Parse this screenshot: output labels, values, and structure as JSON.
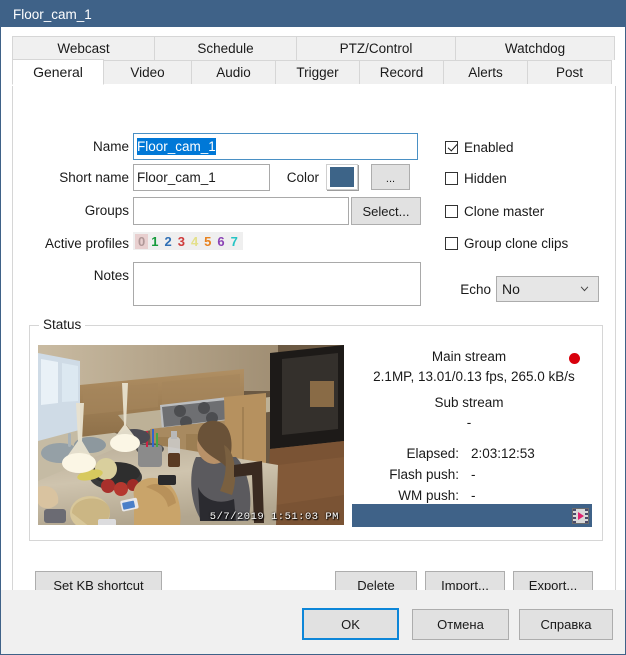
{
  "window": {
    "title": "Floor_cam_1"
  },
  "tabs": {
    "row1": [
      {
        "label": "Webcast",
        "active": false
      },
      {
        "label": "Schedule",
        "active": false
      },
      {
        "label": "PTZ/Control",
        "active": false
      },
      {
        "label": "Watchdog",
        "active": false
      }
    ],
    "row2": [
      {
        "label": "General",
        "active": true
      },
      {
        "label": "Video",
        "active": false
      },
      {
        "label": "Audio",
        "active": false
      },
      {
        "label": "Trigger",
        "active": false
      },
      {
        "label": "Record",
        "active": false
      },
      {
        "label": "Alerts",
        "active": false
      },
      {
        "label": "Post",
        "active": false
      }
    ]
  },
  "form": {
    "name_label": "Name",
    "name_value": "Floor_cam_1",
    "short_name_label": "Short name",
    "short_name_value": "Floor_cam_1",
    "color_label": "Color",
    "color_value": "#3d6488",
    "color_button_label": "...",
    "groups_label": "Groups",
    "groups_value": "",
    "select_button_label": "Select...",
    "active_profiles_label": "Active profiles",
    "profiles": [
      {
        "digit": "0",
        "color": "#b09898",
        "enabled": false
      },
      {
        "digit": "1",
        "color": "#169b3c",
        "enabled": true
      },
      {
        "digit": "2",
        "color": "#2f6fb5",
        "enabled": true
      },
      {
        "digit": "3",
        "color": "#cf3b3b",
        "enabled": true
      },
      {
        "digit": "4",
        "color": "#e4e08a",
        "enabled": true
      },
      {
        "digit": "5",
        "color": "#e8821e",
        "enabled": true
      },
      {
        "digit": "6",
        "color": "#8b43b5",
        "enabled": true
      },
      {
        "digit": "7",
        "color": "#25c4c4",
        "enabled": true
      }
    ],
    "notes_label": "Notes",
    "notes_value": "",
    "checkboxes": [
      {
        "label": "Enabled",
        "checked": true
      },
      {
        "label": "Hidden",
        "checked": false
      },
      {
        "label": "Clone master",
        "checked": false
      },
      {
        "label": "Group clone clips",
        "checked": false
      }
    ],
    "echo_label": "Echo",
    "echo_value": "No"
  },
  "status": {
    "group_title": "Status",
    "preview_timestamp": "5/7/2019 1:51:03 PM",
    "main_stream_label": "Main stream",
    "main_stream_info": "2.1MP, 13.01/0.13 fps,  265.0 kB/s",
    "sub_stream_label": "Sub stream",
    "sub_stream_info": "-",
    "elapsed_label": "Elapsed:",
    "elapsed_value": "2:03:12:53",
    "flash_push_label": "Flash push:",
    "flash_push_value": "-",
    "wm_push_label": "WM push:",
    "wm_push_value": "-",
    "recording_indicator": "record-dot",
    "statusbar_icon": "film-clip-icon"
  },
  "buttons": {
    "set_kb_shortcut": "Set KB shortcut",
    "delete": "Delete",
    "import": "Import...",
    "export": "Export...",
    "ok": "OK",
    "cancel": "Отмена",
    "help": "Справка"
  }
}
